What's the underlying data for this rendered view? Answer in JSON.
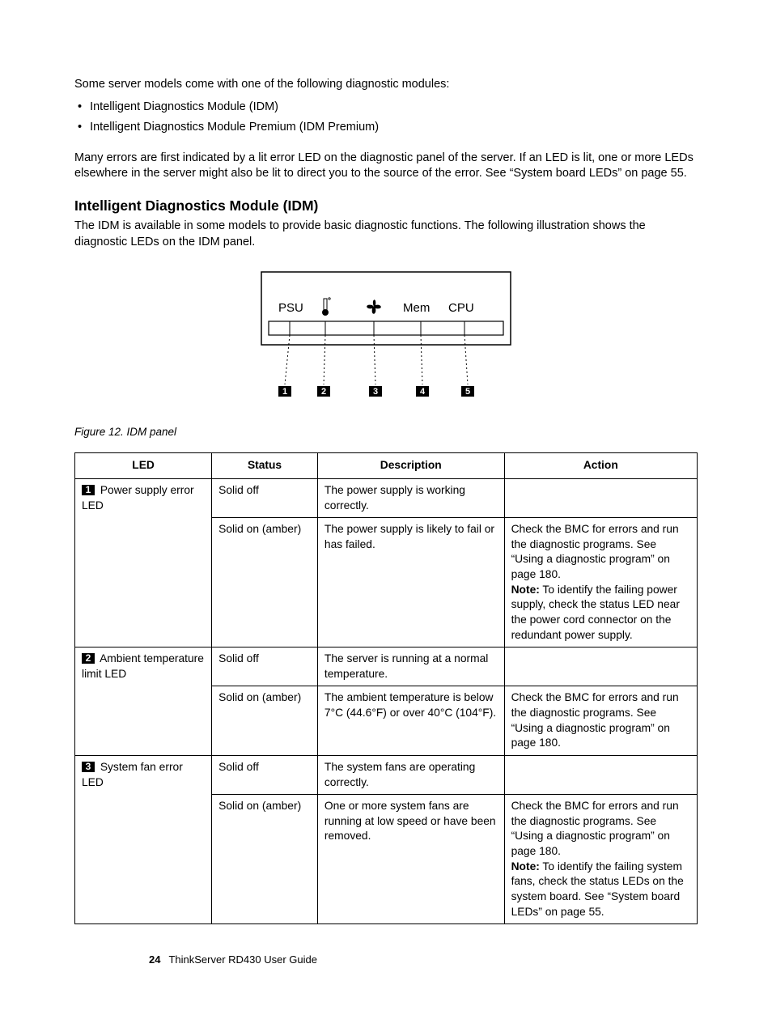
{
  "intro": "Some server models come with one of the following diagnostic modules:",
  "bullets": {
    "b0": "Intelligent Diagnostics Module (IDM)",
    "b1": "Intelligent Diagnostics Module Premium (IDM Premium)"
  },
  "para2": "Many errors are first indicated by a lit error LED on the diagnostic panel of the server. If an LED is lit, one or more LEDs elsewhere in the server might also be lit to direct you to the source of the error. See “System board LEDs” on page 55.",
  "heading": "Intelligent Diagnostics Module (IDM)",
  "heading_para": "The IDM is available in some models to provide basic diagnostic functions. The following illustration shows the diagnostic LEDs on the IDM panel.",
  "figure": {
    "labels": {
      "psu": "PSU",
      "mem": "Mem",
      "cpu": "CPU"
    },
    "caption": "Figure 12.  IDM panel"
  },
  "table": {
    "headers": {
      "led": "LED",
      "status": "Status",
      "description": "Description",
      "action": "Action"
    },
    "rows": [
      {
        "callout": "1",
        "led": " Power supply error LED",
        "sub": [
          {
            "status": "Solid off",
            "desc": "The power supply is working correctly.",
            "action": ""
          },
          {
            "status": "Solid on (amber)",
            "desc": "The power supply is likely to fail or has failed.",
            "action_pre": "Check the BMC for errors and run the diagnostic programs. See “Using a diagnostic program” on page 180.",
            "note_label": "Note:",
            "note_text": " To identify the failing power supply, check the status LED near the power cord connector on the redundant power supply."
          }
        ]
      },
      {
        "callout": "2",
        "led": " Ambient temperature limit LED",
        "sub": [
          {
            "status": "Solid off",
            "desc": "The server is running at a normal temperature.",
            "action": ""
          },
          {
            "status": "Solid on (amber)",
            "desc": "The ambient temperature is below 7°C (44.6°F) or over 40°C (104°F).",
            "action": "Check the BMC for errors and run the diagnostic programs. See “Using a diagnostic program” on page 180."
          }
        ]
      },
      {
        "callout": "3",
        "led": " System fan error LED",
        "sub": [
          {
            "status": "Solid off",
            "desc": "The system fans are operating correctly.",
            "action": ""
          },
          {
            "status": "Solid on (amber)",
            "desc": "One or more system fans are running at low speed or have been removed.",
            "action_pre": "Check the BMC for errors and run the diagnostic programs. See “Using a diagnostic program” on page 180.",
            "note_label": "Note:",
            "note_text": " To identify the failing system fans, check the status LEDs on the system board. See “System board LEDs” on page 55."
          }
        ]
      }
    ]
  },
  "footer": {
    "page": "24",
    "title": "ThinkServer RD430 User Guide"
  }
}
